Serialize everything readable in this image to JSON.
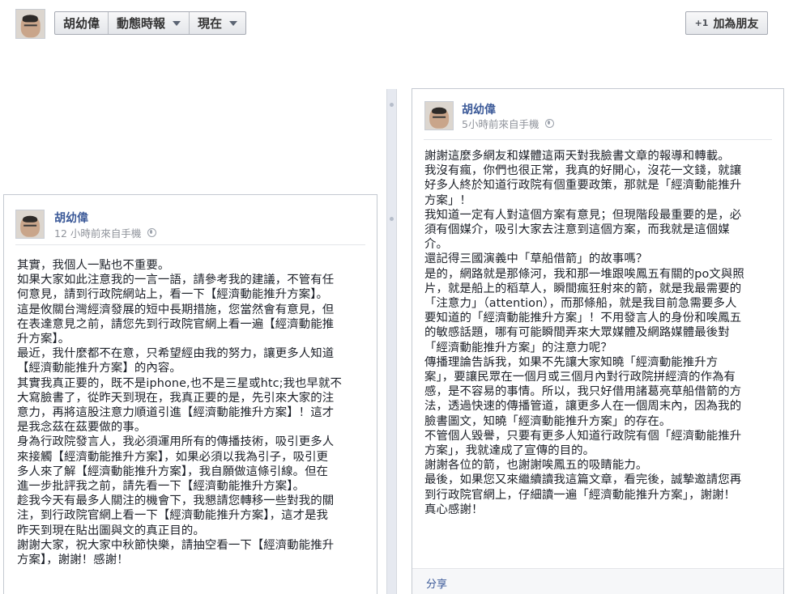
{
  "header": {
    "breadcrumbs": [
      "胡幼偉",
      "動態時報",
      "現在"
    ],
    "add_friend_label": "加為朋友"
  },
  "posts": [
    {
      "author": "胡幼偉",
      "meta": "12 小時前來自手機",
      "lines": [
        "其實，我個人一點也不重要。",
        "如果大家如此注意我的一言一語，請參考我的建議，不管有任",
        "何意見，請到行政院網站上，看一下【經濟動能推升方案】。",
        "這是攸關台灣經濟發展的短中長期措施，您當然會有意見，但",
        "在表達意見之前，請您先到行政院官網上看一遍【經濟動能推",
        "升方案】。",
        "最近，我什麼都不在意，只希望經由我的努力，讓更多人知道",
        "【經濟動能推升方案】的內容。",
        "其實我真正要的，既不是iphone,也不是三星或htc;我也早就不",
        "大寫臉書了，從昨天到現在，我真正要的是，先引來大家的注",
        "意力，再將這股注意力順道引進【經濟動能推升方案】！這才",
        "是我念茲在茲要做的事。",
        "身為行政院發言人，我必須運用所有的傳播技術，吸引更多人",
        "來接觸【經濟動能推升方案】，如果必須以我為引子，吸引更",
        "多人來了解【經濟動能推升方案】，我自願做這條引線。但在",
        "進一步批評我之前，請先看一下【經濟動能推升方案】。",
        "趁我今天有最多人關注的機會下，我懇請您轉移一些對我的關",
        "注，到行政院官網上看一下【經濟動能推升方案】，這才是我",
        "昨天到現在貼出圖與文的真正目的。",
        "謝謝大家，祝大家中秋節快樂，請抽空看一下【經濟動能推升",
        "方案】，謝謝！感謝！"
      ]
    },
    {
      "author": "胡幼偉",
      "meta": "5小時前來自手機",
      "lines": [
        "謝謝這麼多網友和媒體這兩天對我臉書文章的報導和轉載。",
        "我沒有瘋，你們也很正常，我真的好開心，沒花一文錢，就讓",
        "好多人終於知道行政院有個重要政策，那就是「經濟動能推升",
        "方案」！",
        "我知道一定有人對這個方案有意見；但現階段最重要的是，必",
        "須有個媒介，吸引大家去注意到這個方案，而我就是這個媒",
        "介。",
        "還記得三國演義中「草船借箭」的故事嗎？",
        "是的，網路就是那條河，我和那一堆跟唉鳳五有關的po文與照",
        "片，就是船上的稻草人，瞬間瘋狂射來的箭，就是我最需要的",
        "「注意力」（attention），而那條船，就是我目前急需要多人",
        "要知道的「經濟動能推升方案」！不用發言人的身份和唉鳳五",
        "的敏感話題，哪有可能瞬間弄來大眾媒體及網路媒體最後對",
        "「經濟動能推升方案」的注意力呢？",
        "傳播理論告訴我，如果不先讓大家知曉「經濟動能推升方",
        "案」，要讓民眾在一個月或三個月內對行政院拼經濟的作為有",
        "感，是不容易的事情。所以，我只好借用諸葛亮草船借箭的方",
        "法，透過快速的傳播管道，讓更多人在一個周末內，因為我的",
        "臉書圖文，知曉「經濟動能推升方案」的存在。",
        "不管個人毀譽，只要有更多人知道行政院有個「經濟動能推升",
        "方案」，我就達成了宣傳的目的。",
        "謝謝各位的箭，也謝謝唉鳳五的吸睛能力。",
        "最後，如果您又來繼續讀我這篇文章，看完後，誠摯邀請您再",
        "到行政院官網上，仔細讀一遍「經濟動能推升方案」，謝謝！",
        "真心感謝！"
      ],
      "share_label": "分享"
    }
  ]
}
